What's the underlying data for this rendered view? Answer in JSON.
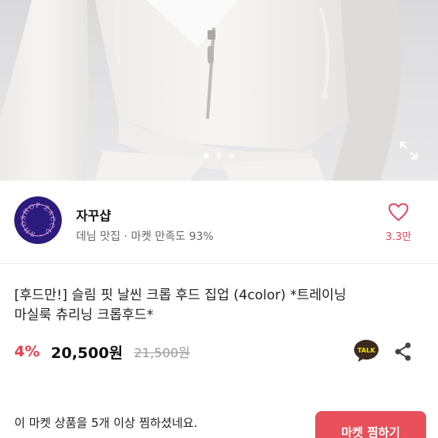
{
  "hero": {
    "dots_count": 3,
    "active_dot": 0,
    "expand_icon": "expand-icon"
  },
  "shop": {
    "logo_text": "SHOP ZACCU",
    "name": "자꾸샵",
    "subtitle": "데님 맛집 · 마켓 만족도 93%",
    "like_icon": "heart-icon",
    "like_count": "3.3만"
  },
  "product": {
    "title_line1": "[후드만!] 슬림 핏 날씬 크롭 후드 집업 (4color) *트레이닝",
    "title_line2": "마실룩 츄리닝 크롭후드*",
    "discount": "4%",
    "price": "20,500원",
    "original_price": "21,500원",
    "talk_label": "TALK",
    "share_icon": "share-icon"
  },
  "promo": {
    "text": "이 마켓 상품을 5개 이상 찜하셨네요.",
    "button_label": "마켓 찜하기"
  },
  "colors": {
    "accent": "#e83f52",
    "logo_bg": "#2b1b7e",
    "talk_bg": "#3c2a21"
  }
}
